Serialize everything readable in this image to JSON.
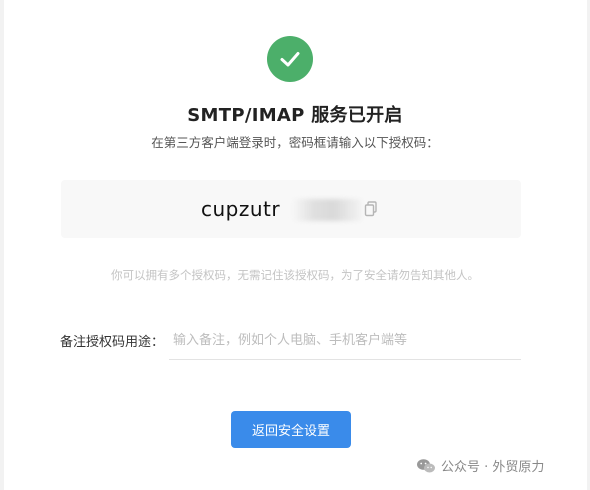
{
  "icons": {
    "success": "check-circle-icon",
    "copy": "copy-icon",
    "wechat": "wechat-icon"
  },
  "colors": {
    "success": "#4caf6a",
    "primary_button": "#3a8bea",
    "hint_text": "#c4c4c4"
  },
  "header": {
    "title": "SMTP/IMAP 服务已开启",
    "instruction": "在第三方客户端登录时，密码框请输入以下授权码："
  },
  "auth_code": {
    "visible_value": "cupzutr"
  },
  "hint": "你可以拥有多个授权码，无需记住该授权码，为了安全请勿告知其他人。",
  "remark": {
    "label": "备注授权码用途：",
    "placeholder": "输入备注，例如个人电脑、手机客户端等",
    "value": ""
  },
  "actions": {
    "return_label": "返回安全设置"
  },
  "watermark": {
    "text": "公众号 · 外贸原力"
  }
}
